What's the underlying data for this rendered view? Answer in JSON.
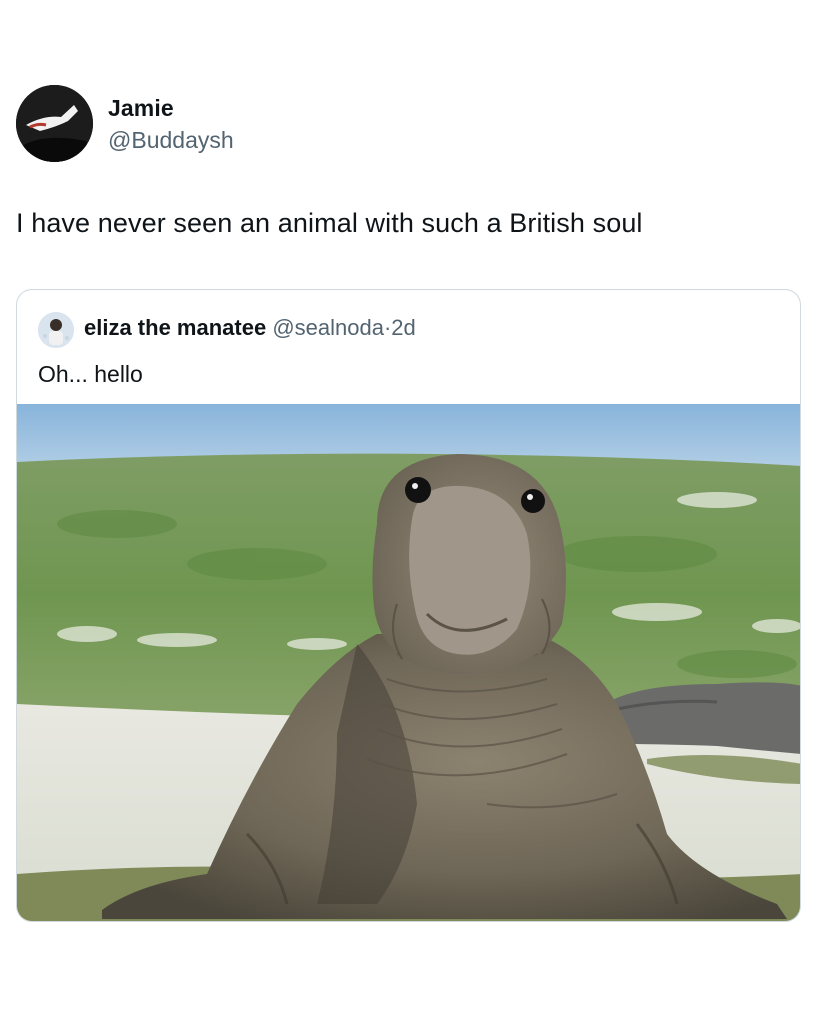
{
  "tweet": {
    "author_name": "Jamie",
    "author_handle": "@Buddaysh",
    "text": "I have never seen an animal with such a British soul",
    "avatar_icon": "profile-avatar-icon"
  },
  "quote": {
    "author_name": "eliza the manatee",
    "author_handle": "@sealnoda",
    "separator": "·",
    "time": "2d",
    "text": "Oh... hello",
    "avatar_icon": "profile-avatar-icon",
    "media": "photo-elephant-seal"
  },
  "colors": {
    "primary_text": "#0f1419",
    "secondary_text": "#536471",
    "border": "#cfd9de",
    "background": "#ffffff"
  }
}
